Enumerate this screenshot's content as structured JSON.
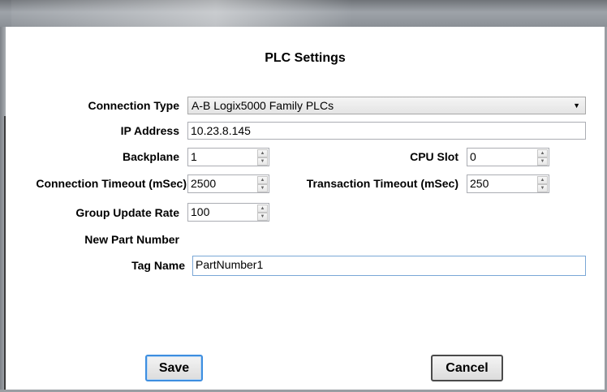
{
  "dialog": {
    "title": "PLC Settings"
  },
  "form": {
    "connection_type": {
      "label": "Connection Type",
      "value": "A-B Logix5000 Family PLCs"
    },
    "ip_address": {
      "label": "IP Address",
      "value": "10.23.8.145"
    },
    "backplane": {
      "label": "Backplane",
      "value": "1"
    },
    "cpu_slot": {
      "label": "CPU Slot",
      "value": "0"
    },
    "connection_timeout": {
      "label": "Connection Timeout (mSec)",
      "value": "2500"
    },
    "transaction_timeout": {
      "label": "Transaction Timeout (mSec)",
      "value": "250"
    },
    "group_update_rate": {
      "label": "Group Update Rate",
      "value": "100"
    },
    "new_part_number": {
      "heading": "New Part Number"
    },
    "tag_name": {
      "label": "Tag Name",
      "value": "PartNumber1"
    }
  },
  "buttons": {
    "save": "Save",
    "cancel": "Cancel"
  },
  "icons": {
    "dropdown": "chevron-down-icon",
    "spin_up": "spin-up-icon",
    "spin_down": "spin-down-icon"
  },
  "colors": {
    "focus_border": "#3d8ee0",
    "field_border": "#abadb3"
  }
}
